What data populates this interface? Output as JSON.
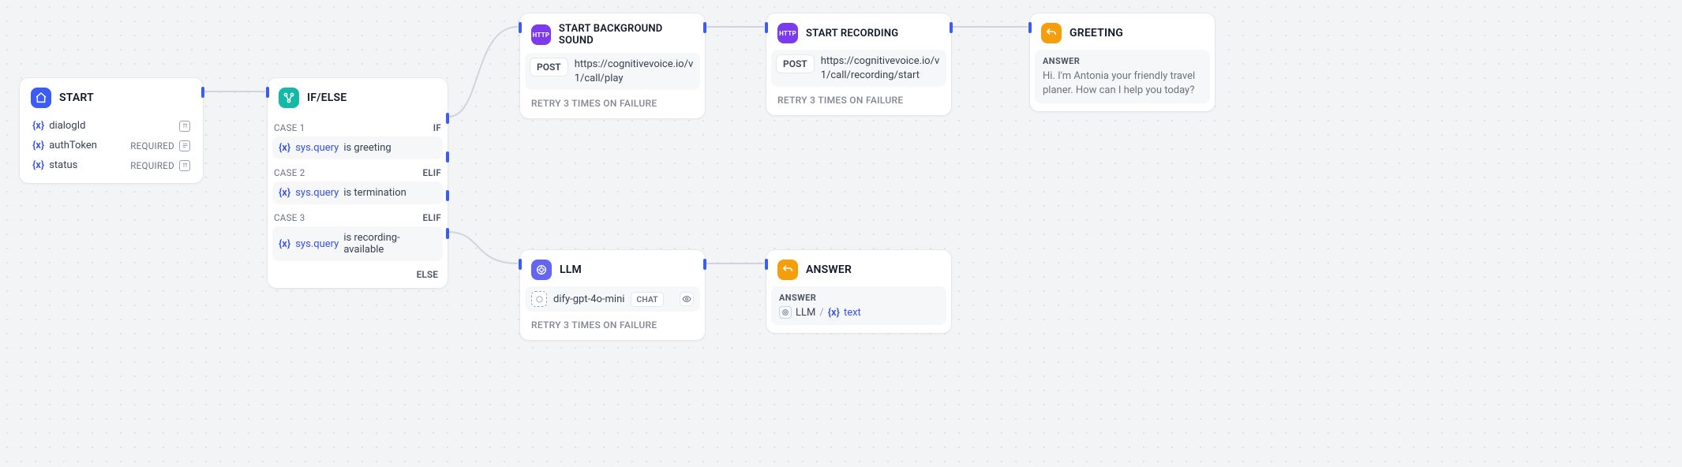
{
  "nodes": {
    "start": {
      "title": "START",
      "vars": [
        {
          "name": "dialogId",
          "tag": "",
          "icon": "text"
        },
        {
          "name": "authToken",
          "tag": "REQUIRED",
          "icon": "para"
        },
        {
          "name": "status",
          "tag": "REQUIRED",
          "icon": "text"
        }
      ]
    },
    "ifelse": {
      "title": "IF/ELSE",
      "cases": [
        {
          "head": "CASE 1",
          "kw": "IF",
          "var": "sys.query",
          "cond": " is greeting"
        },
        {
          "head": "CASE 2",
          "kw": "ELIF",
          "var": "sys.query",
          "cond": " is termination"
        },
        {
          "head": "CASE 3",
          "kw": "ELIF",
          "var": "sys.query",
          "cond": " is recording-available"
        }
      ],
      "else": "ELSE"
    },
    "bgsound": {
      "title": "START BACKGROUND SOUND",
      "method": "POST",
      "url": "https://cognitivevoice.io/v1/call/play",
      "retry": "RETRY 3 TIMES ON FAILURE",
      "http_badge": "HTTP"
    },
    "recording": {
      "title": "START RECORDING",
      "method": "POST",
      "url": "https://cognitivevoice.io/v1/call/recording/start",
      "retry": "RETRY 3 TIMES ON FAILURE",
      "http_badge": "HTTP"
    },
    "greeting": {
      "title": "GREETING",
      "answer_label": "ANSWER",
      "answer_text": "Hi. I'm Antonia your friendly travel planer. How can I help you today?"
    },
    "llm": {
      "title": "LLM",
      "model": "dify-gpt-4o-mini",
      "chip": "CHAT",
      "retry": "RETRY 3 TIMES ON FAILURE"
    },
    "answer": {
      "title": "ANSWER",
      "answer_label": "ANSWER",
      "ref_node": "LLM",
      "ref_var": "text"
    }
  },
  "var_prefix": "{x}",
  "slash": "/"
}
